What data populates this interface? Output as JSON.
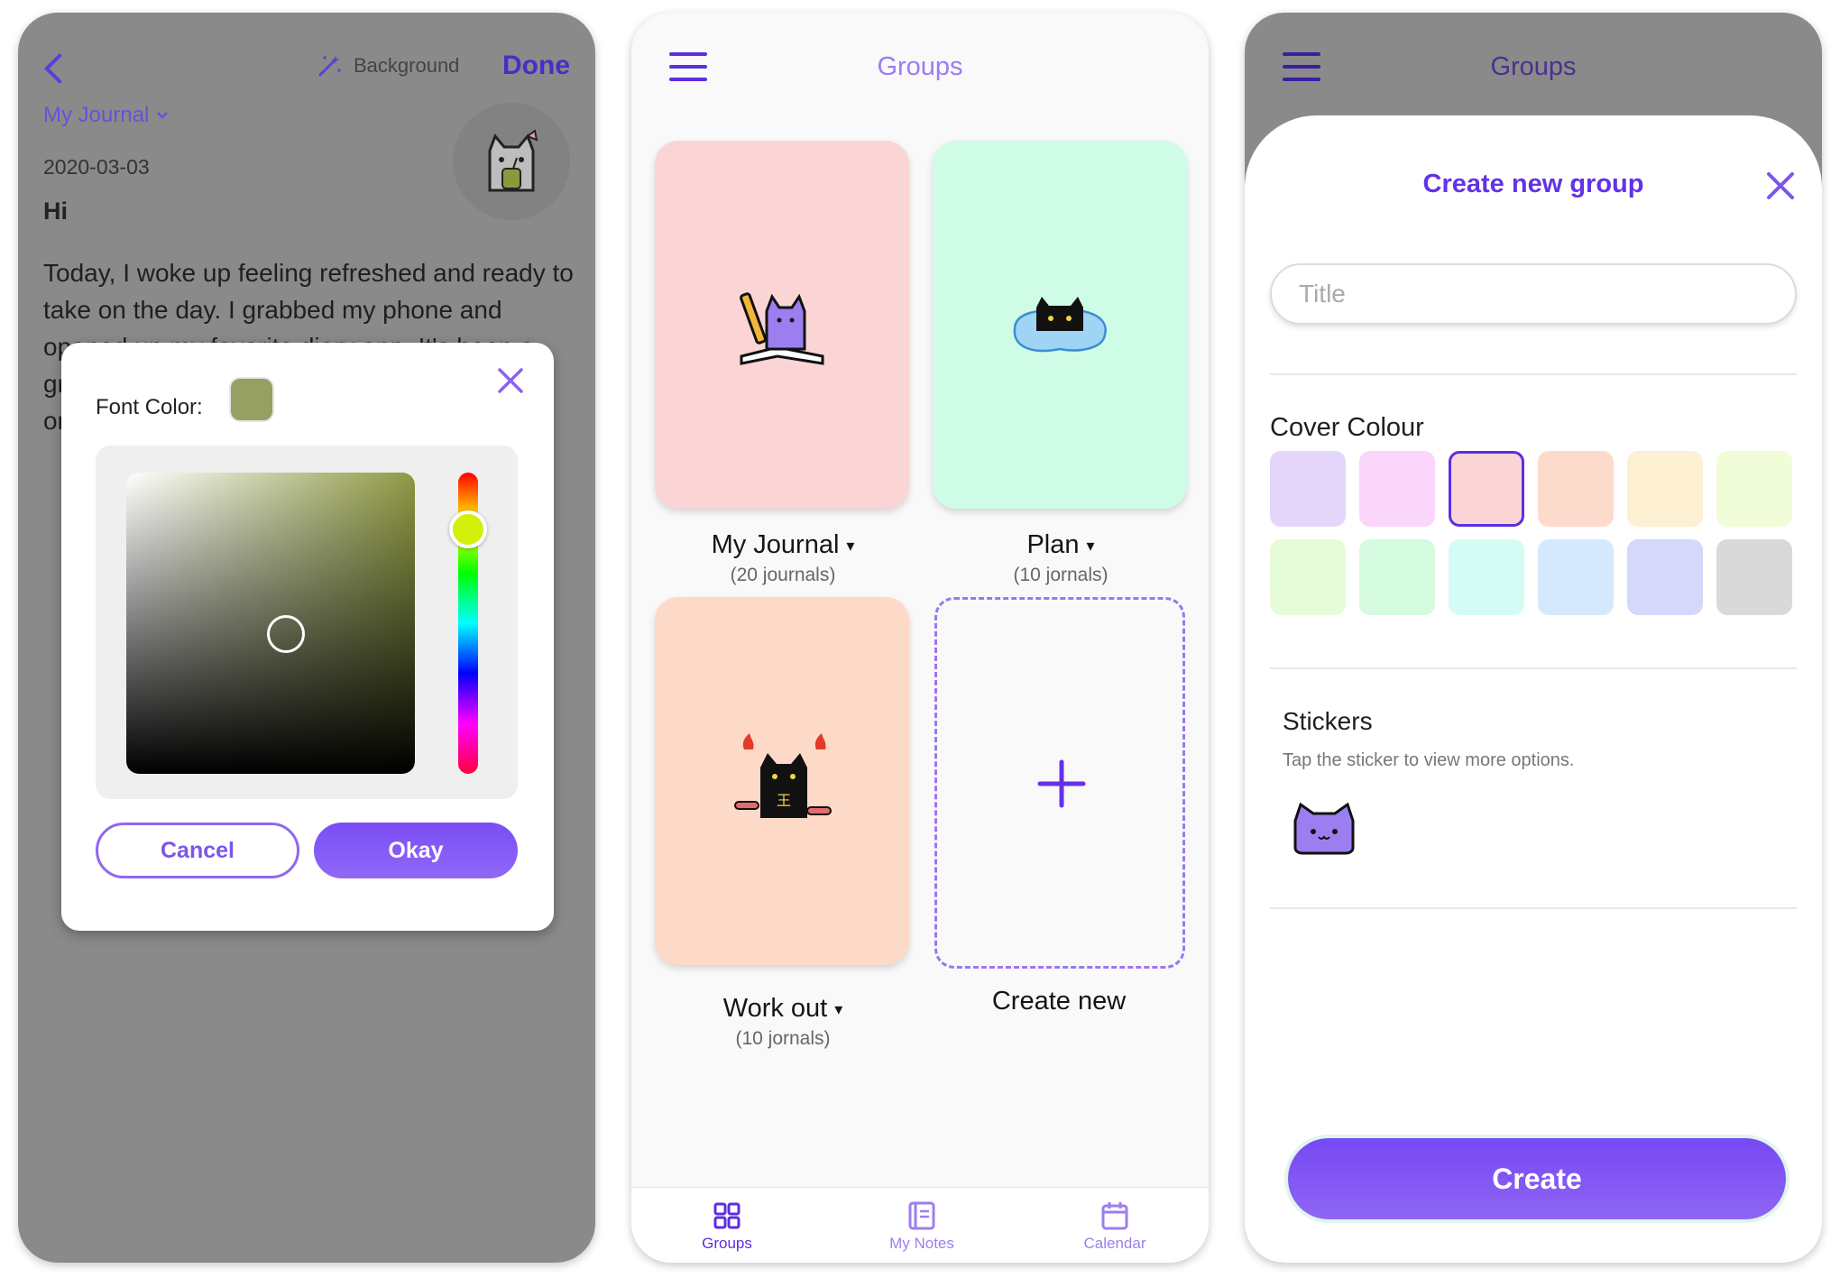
{
  "editor": {
    "background_label": "Background",
    "done_label": "Done",
    "journal_name": "My Journal",
    "date": "2020-03-03",
    "entry_title": "Hi",
    "body_text": "Today, I woke up feeling refreshed and ready to take on the day. I grabbed my phone and opened up my favorite diary app. It's been a great way to keep my thoughts and memories organized and...",
    "color_dialog": {
      "font_color_label": "Font Color:",
      "selected_color": "#96a063",
      "cancel_label": "Cancel",
      "okay_label": "Okay"
    }
  },
  "groups_screen": {
    "title": "Groups",
    "groups": [
      {
        "name": "My Journal",
        "count": "(20 journals)",
        "color": "#fbd4d5"
      },
      {
        "name": "Plan",
        "count": "(10 jornals)",
        "color": "#cffce6"
      },
      {
        "name": "Work out",
        "count": "(10 jornals)",
        "color": "#fdd9c8"
      }
    ],
    "create_new_label": "Create new",
    "nav": {
      "groups": "Groups",
      "my_notes": "My Notes",
      "calendar": "Calendar"
    }
  },
  "create_group": {
    "header_title": "Groups",
    "sheet_title": "Create new group",
    "title_placeholder": "Title",
    "cover_colour_label": "Cover Colour",
    "colours": [
      "#e4d6fb",
      "#fbd6fb",
      "#fbd4d5",
      "#fcdbcd",
      "#fdf0d3",
      "#f1fcd9",
      "#e6fcd8",
      "#d4fadf",
      "#d5fcf4",
      "#d6e9fc",
      "#d6d8fb",
      "#d9d9d9"
    ],
    "selected_colour": "#fbd4d5",
    "stickers_label": "Stickers",
    "stickers_hint": "Tap the sticker to view more options.",
    "create_label": "Create"
  }
}
